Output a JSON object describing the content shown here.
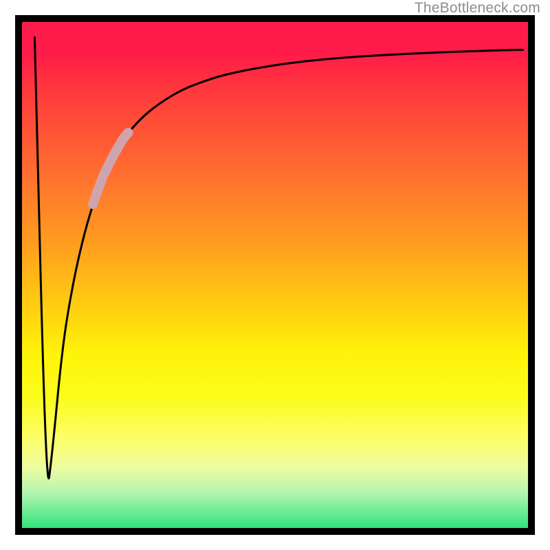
{
  "watermark": {
    "text": "TheBottleneck.com"
  },
  "chart_data": {
    "type": "line",
    "title": "",
    "xlabel": "",
    "ylabel": "",
    "xlim": [
      0,
      100
    ],
    "ylim": [
      0,
      100
    ],
    "grid": false,
    "legend": false,
    "series": [
      {
        "name": "bottleneck-curve",
        "x": [
          2.5,
          4.8,
          6.0,
          8.0,
          10.0,
          12.0,
          14.0,
          16.0,
          18.0,
          20.0,
          24.0,
          28.0,
          32.0,
          36.0,
          40.0,
          48.0,
          56.0,
          64.0,
          72.0,
          80.0,
          88.0,
          96.0,
          99.0
        ],
        "y": [
          97.0,
          5.5,
          15.0,
          36.0,
          48.0,
          57.0,
          64.0,
          69.5,
          73.5,
          77.0,
          81.5,
          84.5,
          86.8,
          88.3,
          89.6,
          91.2,
          92.3,
          93.0,
          93.5,
          93.9,
          94.2,
          94.45,
          94.5
        ]
      }
    ],
    "highlight_segment": {
      "x_start": 14.0,
      "x_end": 21.0
    },
    "background": {
      "type": "vertical-gradient",
      "stops": [
        {
          "pct": 0,
          "color": "#ff1b49"
        },
        {
          "pct": 30,
          "color": "#ff6f2f"
        },
        {
          "pct": 55,
          "color": "#ffc912"
        },
        {
          "pct": 75,
          "color": "#fcfc1a"
        },
        {
          "pct": 93,
          "color": "#b4f6af"
        },
        {
          "pct": 100,
          "color": "#32e27e"
        }
      ]
    }
  }
}
